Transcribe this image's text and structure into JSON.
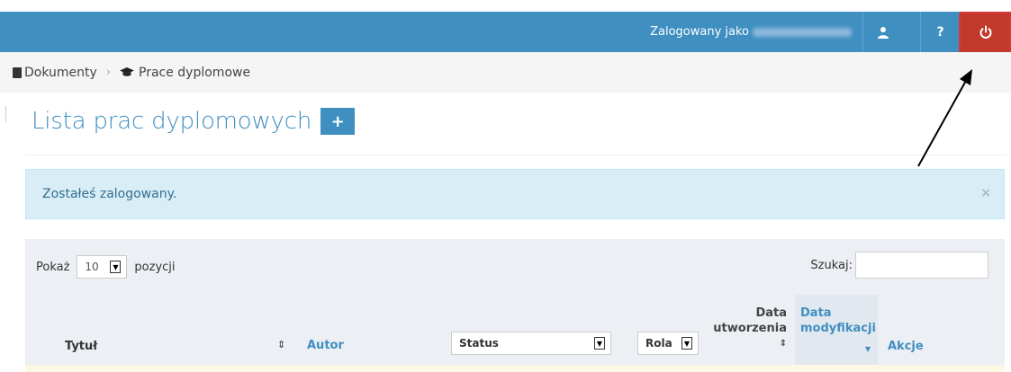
{
  "header": {
    "logged_in_label": "Zalogowany jako",
    "user_icon": "user-icon",
    "help_label": "?",
    "power_icon": "power-icon",
    "accent_color": "#3f8fc1",
    "logout_color": "#c0392b"
  },
  "breadcrumb": {
    "items": [
      {
        "label": "Dokumenty",
        "icon": "document-icon"
      },
      {
        "label": "Prace dyplomowe",
        "icon": "graduation-cap-icon"
      }
    ],
    "separator": "›"
  },
  "page": {
    "title": "Lista prac dyplomowych",
    "add_label": "+"
  },
  "alert": {
    "message": "Zostałeś zalogowany.",
    "close": "×"
  },
  "table_controls": {
    "show_prefix": "Pokaż",
    "page_size": "10",
    "show_suffix": "pozycji",
    "search_label": "Szukaj:",
    "search_value": ""
  },
  "table": {
    "columns": {
      "title": "Tytuł",
      "author": "Autor",
      "status": "Status",
      "role": "Rola",
      "created_line1": "Data",
      "created_line2": "utworzenia",
      "modified_line1": "Data",
      "modified_line2": "modyfikacji",
      "actions": "Akcje"
    }
  }
}
